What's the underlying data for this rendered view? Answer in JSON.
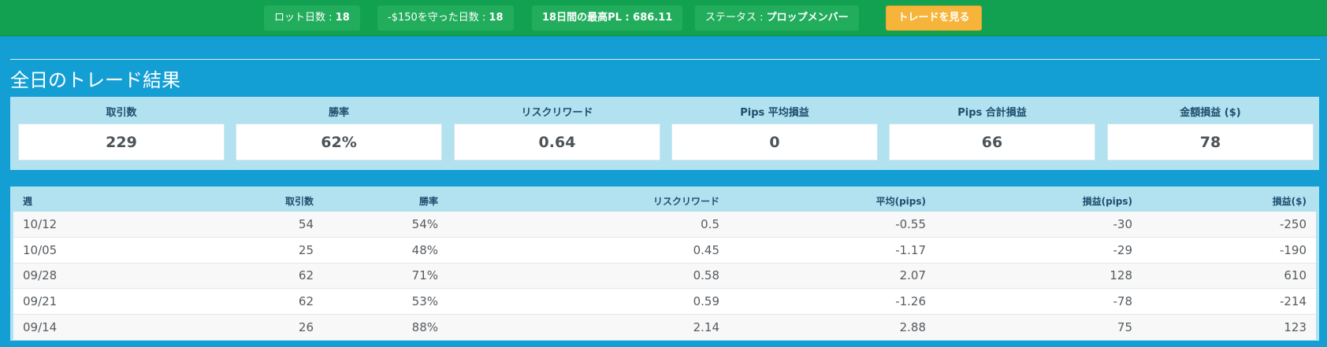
{
  "header": {
    "lot_days": {
      "label": "ロット日数 : ",
      "value": "18"
    },
    "kept_150_days": {
      "label": "-$150を守った日数 : ",
      "value": "18"
    },
    "max_pl": {
      "label": "18日間の最高PL : ",
      "value": "686.11"
    },
    "status": {
      "label": "ステータス : ",
      "value": "プロップメンバー"
    },
    "view_trades_button": "トレードを見る"
  },
  "summary": {
    "title": "全日のトレード結果",
    "stats": [
      {
        "label": "取引数",
        "value": "229"
      },
      {
        "label": "勝率",
        "value": "62%"
      },
      {
        "label": "リスクリワード",
        "value": "0.64"
      },
      {
        "label": "Pips 平均損益",
        "value": "0"
      },
      {
        "label": "Pips 合計損益",
        "value": "66"
      },
      {
        "label": "金額損益 ($)",
        "value": "78"
      }
    ]
  },
  "weekly_table": {
    "columns": [
      "週",
      "取引数",
      "勝率",
      "リスクリワード",
      "平均(pips)",
      "損益(pips)",
      "損益($)"
    ],
    "rows": [
      [
        "10/12",
        "54",
        "54%",
        "0.5",
        "-0.55",
        "-30",
        "-250"
      ],
      [
        "10/05",
        "25",
        "48%",
        "0.45",
        "-1.17",
        "-29",
        "-190"
      ],
      [
        "09/28",
        "62",
        "71%",
        "0.58",
        "2.07",
        "128",
        "610"
      ],
      [
        "09/21",
        "62",
        "53%",
        "0.59",
        "-1.26",
        "-78",
        "-214"
      ],
      [
        "09/14",
        "26",
        "88%",
        "2.14",
        "2.88",
        "75",
        "123"
      ]
    ]
  },
  "colors": {
    "header_bg": "#12a150",
    "page_bg": "#149fd4",
    "panel_bg": "#b2e1f0",
    "button_bg": "#f6b43b"
  }
}
